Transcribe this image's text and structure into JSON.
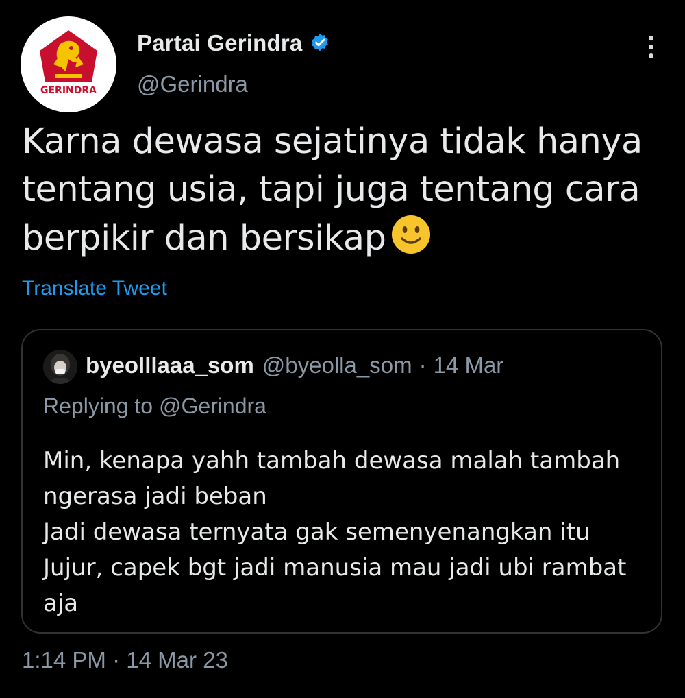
{
  "author": {
    "display_name": "Partai Gerindra",
    "handle": "@Gerindra",
    "avatar_text": "GERINDRA",
    "verified": true
  },
  "tweet": {
    "text_lines": [
      "Karna dewasa sejatinya tidak hanya",
      "tentang usia, tapi juga tentang cara",
      "berpikir dan bersikap"
    ],
    "emoji": "slightly-smiling-face",
    "translate_label": "Translate Tweet",
    "timestamp": "1:14 PM · 14 Mar 23"
  },
  "quoted_tweet": {
    "display_name": "byeolllaaa_som",
    "handle": "@byeolla_som",
    "separator": "·",
    "date": "14 Mar",
    "replying_to": "Replying to @Gerindra",
    "text_lines": [
      "Min, kenapa yahh tambah dewasa malah tambah",
      "ngerasa jadi beban",
      "Jadi dewasa ternyata gak semenyenangkan itu",
      "Jujur, capek bgt jadi manusia mau jadi ubi rambat",
      "aja"
    ]
  },
  "colors": {
    "background": "#000000",
    "primary_text": "#e7e9ea",
    "secondary_text": "#8b98a5",
    "link": "#1d9bf0",
    "border": "#2f3336",
    "logo_red": "#c8102e",
    "logo_gold": "#f5c400"
  }
}
